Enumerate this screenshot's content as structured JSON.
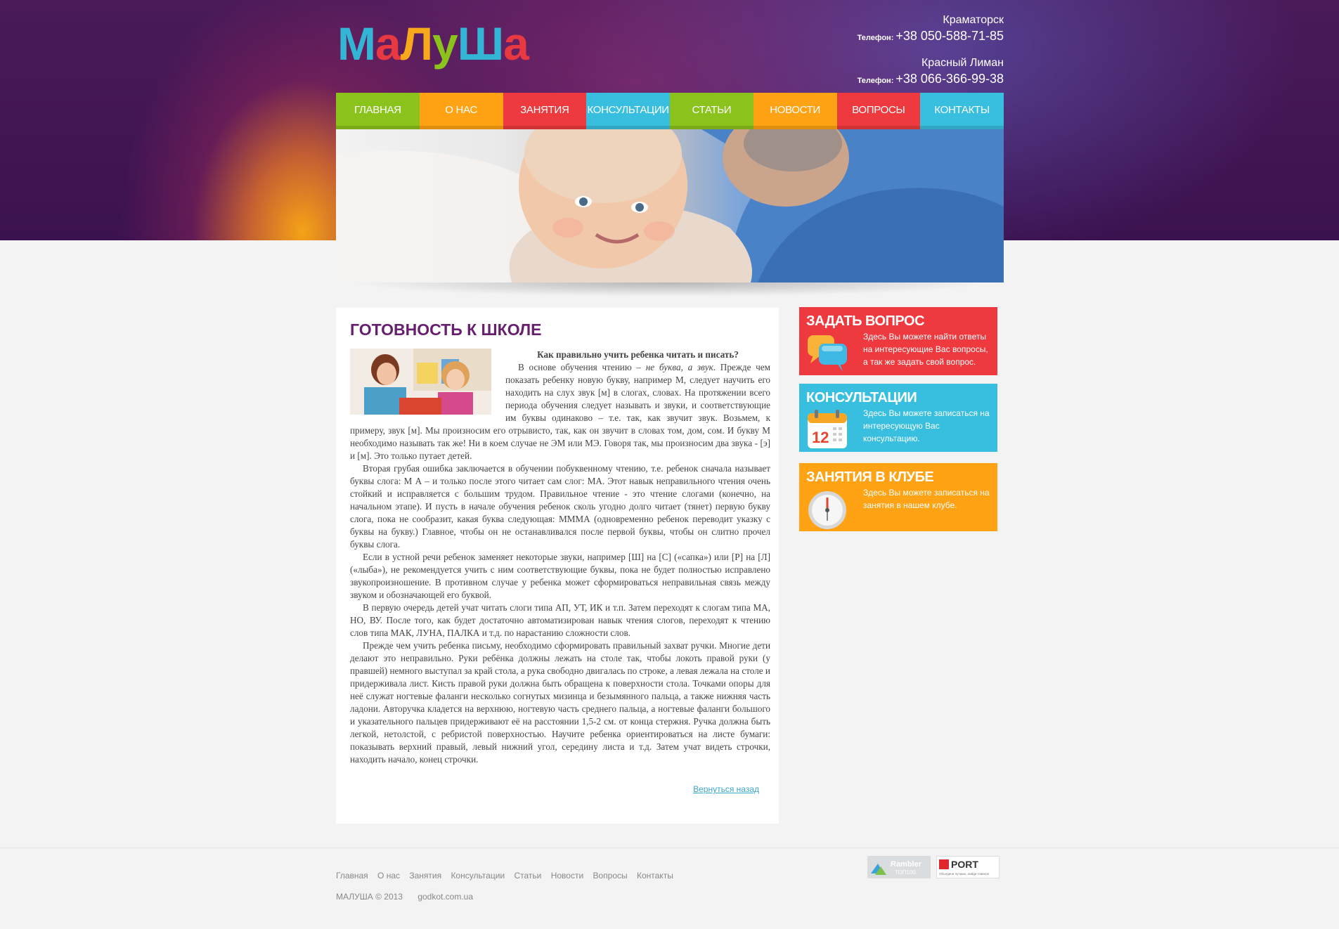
{
  "logo": {
    "letters": [
      "М",
      "а",
      "Л",
      "у",
      "Ш",
      "а"
    ],
    "colors": [
      "#33b5d6",
      "#e83842",
      "#f7a81b",
      "#8bc21c",
      "#33b5d6",
      "#e83842"
    ]
  },
  "contacts": [
    {
      "city": "Краматорск",
      "label": "Телефон:",
      "phone": "+38 050-588-71-85"
    },
    {
      "city": "Красный Лиман",
      "label": "Телефон:",
      "phone": "+38 066-366-99-38"
    }
  ],
  "nav": [
    {
      "label": "Главная",
      "color": "#8bc21c"
    },
    {
      "label": "О нас",
      "color": "#ffa213"
    },
    {
      "label": "Занятия",
      "color": "#ee3a3e"
    },
    {
      "label": "Консультации",
      "color": "#38bfdf"
    },
    {
      "label": "Статьи",
      "color": "#8bc21c"
    },
    {
      "label": "Новости",
      "color": "#ffa213"
    },
    {
      "label": "Вопросы",
      "color": "#ee3a3e"
    },
    {
      "label": "Контакты",
      "color": "#38bfdf"
    }
  ],
  "article": {
    "title": "Готовность к школе",
    "question": "Как правильно учить ребенка читать и писать?",
    "p1_start": "В основе обучения чтению – ",
    "p1_em": "не буква, а звук",
    "p1_rest": ". Прежде чем показать ребенку новую букву, например М, следует научить его находить на слух звук [м] в слогах, словах. На протяжении всего периода обучения следует называть и звуки, и соответствующие им буквы одинаково – т.е. так, как звучит звук. Возьмем, к примеру, звук [м]. Мы произносим его отрывисто, так, как он звучит в словах том, дом, сом. И букву М необходимо называть так же! Ни в коем случае не ЭМ или МЭ. Говоря так, мы произносим два звука - [э] и [м]. Это только путает детей.",
    "p2": "Вторая грубая ошибка заключается в обучении побуквенному чтению, т.е. ребенок сначала называет буквы слога: М А – и только после этого читает сам слог: МА. Этот навык неправильного чтения очень стойкий и исправляется с большим трудом. Правильное чтение - это чтение слогами (конечно, на начальном этапе). И пусть в начале обучения ребенок сколь угодно долго читает (тянет) первую букву слога, пока не сообразит, какая буква следующая: МММА (одновременно ребенок переводит указку с буквы на букву.) Главное, чтобы он не останавливался после первой буквы, чтобы он слитно прочел буквы слога.",
    "p3": "Если в устной речи ребенок заменяет некоторые звуки, например [Ш] на [С] («сапка») или [Р] на [Л] («лыба»), не рекомендуется учить с ним соответствующие буквы, пока не будет полностью исправлено звукопроизношение. В противном случае у ребенка может сформироваться неправильная связь между звуком и обозначающей его буквой.",
    "p4": "В первую очередь детей учат читать слоги типа АП, УТ, ИК и т.п. Затем переходят к слогам типа МА, НО, ВУ. После того, как будет достаточно автоматизирован навык чтения слогов, переходят к чтению слов типа МАК, ЛУНА, ПАЛКА и т.д. по нарастанию сложности слов.",
    "p5": "Прежде чем учить ребенка письму, необходимо сформировать правильный захват ручки. Многие дети делают это неправильно. Руки ребёнка должны лежать на столе так, чтобы локоть правой руки (у правшей) немного выступал за край стола, а рука свободно двигалась по строке, а левая лежала на столе и придерживала лист. Кисть правой руки должна быть обращена к поверхности стола. Точками опоры для неё служат ногтевые фаланги несколько согнутых мизинца и безымянного пальца, а также нижняя часть ладони. Авторучка кладется на верхнюю, ногтевую часть среднего пальца, а ногтевые фаланги большого и указательного пальцев придерживают её на расстоянии 1,5-2 см. от конца стержня. Ручка должна быть легкой, нетолстой, с ребристой поверхностью. Научите ребенка ориентироваться на листе бумаги: показывать верхний правый, левый нижний угол, середину листа и т.д. Затем учат видеть строчки, находить начало, конец строчки.",
    "back": "Вернуться назад"
  },
  "side": [
    {
      "title": "Задать вопрос",
      "text": "Здесь Вы можете найти ответы на интересующие Вас вопросы, а так же задать свой вопрос.",
      "color": "#ee3a3e",
      "icon": "chat-bubbles-icon"
    },
    {
      "title": "Консультации",
      "text": "Здесь Вы можете записаться на интересующую Вас консультацию.",
      "color": "#38bfdf",
      "icon": "calendar-icon",
      "calendar_day": "12"
    },
    {
      "title": "Занятия в клубе",
      "text": "Здесь Вы можете записаться на занятия в нашем клубе.",
      "color": "#ffa213",
      "icon": "clock-icon"
    }
  ],
  "footer": {
    "links": [
      "Главная",
      "О нас",
      "Занятия",
      "Консультации",
      "Статьи",
      "Новости",
      "Вопросы",
      "Контакты"
    ],
    "copyright": "МАЛУША © 2013",
    "site": "godkot.com.ua",
    "counter1": {
      "name": "Rambler",
      "sub": "ТОП100"
    },
    "counter2": {
      "name": "PORT",
      "sub": "Объедини лучших, найди главное"
    }
  }
}
